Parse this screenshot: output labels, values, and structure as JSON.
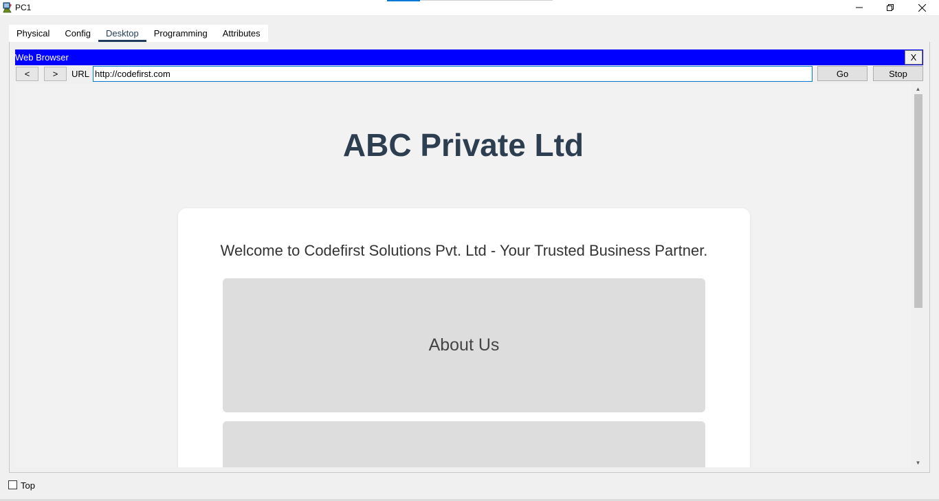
{
  "window": {
    "title": "PC1",
    "icon": "packet-tracer-pc-icon",
    "controls": [
      "minimize-icon",
      "restore-icon",
      "close-icon"
    ]
  },
  "tabs": [
    {
      "label": "Physical",
      "active": false
    },
    {
      "label": "Config",
      "active": false
    },
    {
      "label": "Desktop",
      "active": true
    },
    {
      "label": "Programming",
      "active": false
    },
    {
      "label": "Attributes",
      "active": false
    }
  ],
  "web_browser": {
    "title": "Web Browser",
    "close_label": "X",
    "back_label": "<",
    "forward_label": ">",
    "url_label": "URL",
    "url_value": "http://codefirst.com",
    "go_label": "Go",
    "stop_label": "Stop",
    "header_color": "#0000ff"
  },
  "page": {
    "title": "ABC Private Ltd",
    "welcome": "Welcome to Codefirst Solutions Pvt. Ltd - Your Trusted Business Partner.",
    "sections": [
      "About Us"
    ]
  },
  "footer": {
    "top_label": "Top",
    "top_checked": false
  }
}
